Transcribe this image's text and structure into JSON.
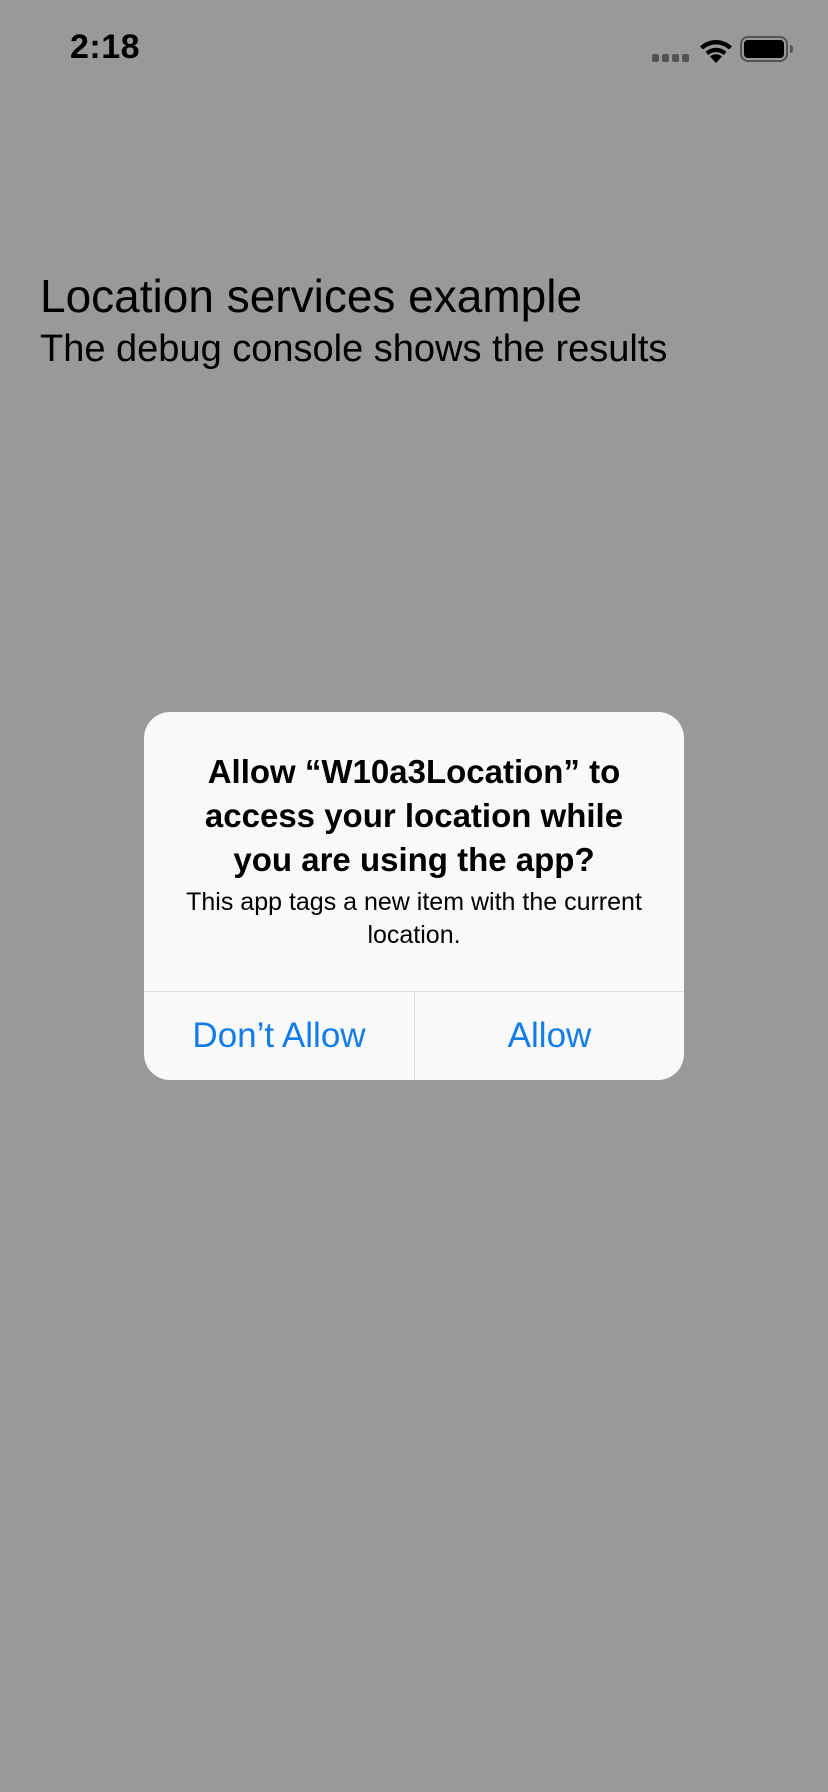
{
  "status_bar": {
    "time": "2:18",
    "icons": [
      "cellular-signal-icon",
      "wifi-icon",
      "battery-icon"
    ]
  },
  "app": {
    "title": "Location services example",
    "subtitle": "The debug console shows the results"
  },
  "alert": {
    "title": "Allow “W10a3Location” to access your location while you are using the app?",
    "message": "This app tags a new item with the current location.",
    "buttons": {
      "dont_allow": "Don’t Allow",
      "allow": "Allow"
    }
  },
  "colors": {
    "accent": "#127ce8",
    "overlay": "#999999",
    "alert_background": "#f9f9f9"
  }
}
